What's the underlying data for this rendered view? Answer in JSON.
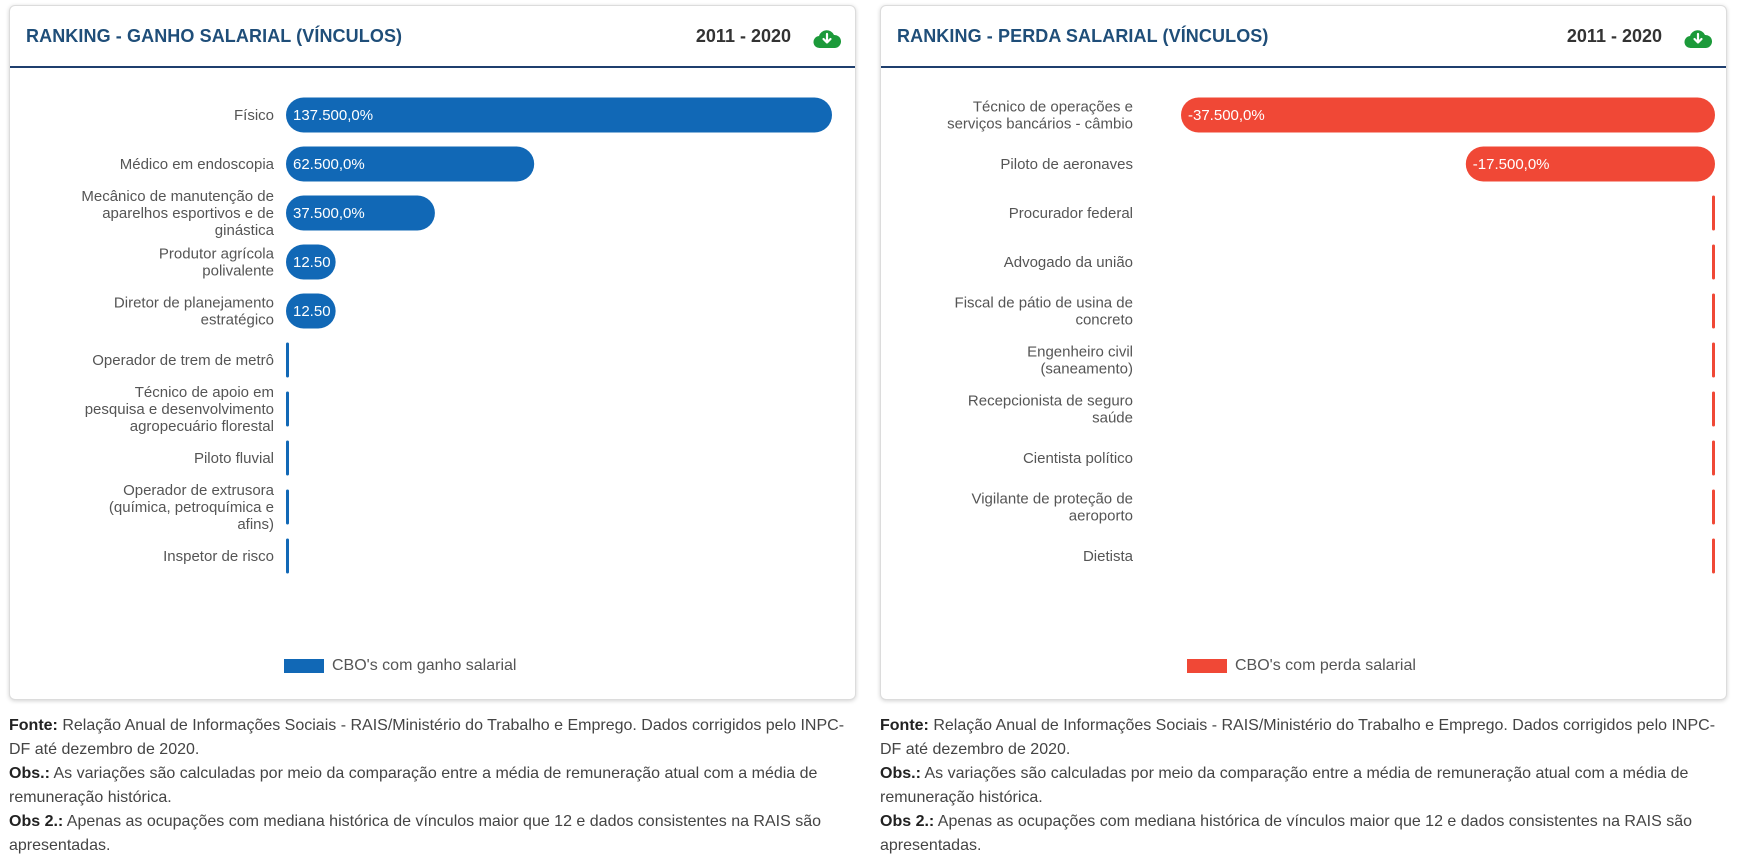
{
  "panels": [
    {
      "id": "gain",
      "title": "RANKING - GANHO SALARIAL (VÍNCULOS)",
      "period": "2011 - 2020",
      "download_icon": "cloud-download-icon",
      "legend": "CBO's com ganho salarial",
      "color": "#1168b6",
      "chart_data": {
        "type": "bar",
        "orientation": "horizontal",
        "categories": [
          "Físico",
          "Médico em endoscopia",
          "Mecânico de manutenção de aparelhos esportivos e de ginástica",
          "Produtor agrícola polivalente",
          "Diretor de planejamento estratégico",
          "Operador de trem de metrô",
          "Técnico de apoio em pesquisa e desenvolvimento agropecuário florestal",
          "Piloto fluvial",
          "Operador de extrusora (química, petroquímica e afins)",
          "Inspetor de risco"
        ],
        "values": [
          137500,
          62500,
          37500,
          12500,
          12500,
          1000,
          700,
          500,
          500,
          400
        ],
        "data_labels": [
          "137.500,0%",
          "62.500,0%",
          "37.500,0%",
          "12.50",
          "12.50",
          "",
          "",
          "",
          "",
          ""
        ],
        "series": [
          {
            "name": "CBO's com ganho salarial",
            "values": [
              137500,
              62500,
              37500,
              12500,
              12500,
              1000,
              700,
              500,
              500,
              400
            ]
          }
        ],
        "xlim": [
          0,
          137500
        ],
        "grid": false,
        "legend_placement": "bottom"
      }
    },
    {
      "id": "loss",
      "title": "RANKING - PERDA SALARIAL (VÍNCULOS)",
      "period": "2011 - 2020",
      "download_icon": "cloud-download-icon",
      "legend": "CBO's com perda salarial",
      "color": "#f04836",
      "chart_data": {
        "type": "bar",
        "orientation": "horizontal",
        "categories": [
          "Técnico de operações e serviços bancários - câmbio",
          "Piloto de aeronaves",
          "Procurador federal",
          "Advogado da união",
          "Fiscal de pátio de usina de concreto",
          "Engenheiro civil (saneamento)",
          "Recepcionista de seguro saúde",
          "Cientista político",
          "Vigilante de proteção de aeroporto",
          "Dietista"
        ],
        "values": [
          -37500,
          -17500,
          -100,
          -100,
          -100,
          -100,
          -100,
          -100,
          -100,
          -100
        ],
        "data_labels": [
          "-37.500,0%",
          "-17.500,0%",
          "",
          "",
          "",
          "",
          "",
          "",
          "",
          ""
        ],
        "series": [
          {
            "name": "CBO's com perda salarial",
            "values": [
              -37500,
              -17500,
              -100,
              -100,
              -100,
              -100,
              -100,
              -100,
              -100,
              -100
            ]
          }
        ],
        "xlim": [
          -37500,
          0
        ],
        "grid": false,
        "legend_placement": "bottom"
      }
    }
  ],
  "notes": {
    "fonte_label": "Fonte:",
    "fonte_text": " Relação Anual de Informações Sociais - RAIS/Ministério do Trabalho e Emprego. Dados corrigidos pelo INPC-DF até dezembro de 2020.",
    "obs_label": "Obs.:",
    "obs_text": " As variações são calculadas por meio da comparação entre a média de remuneração atual com a média de remuneração histórica.",
    "obs2_label": "Obs 2.:",
    "obs2_text": " Apenas as ocupações com mediana histórica de vínculos maior que 12 e dados consistentes na RAIS são apresentadas."
  }
}
